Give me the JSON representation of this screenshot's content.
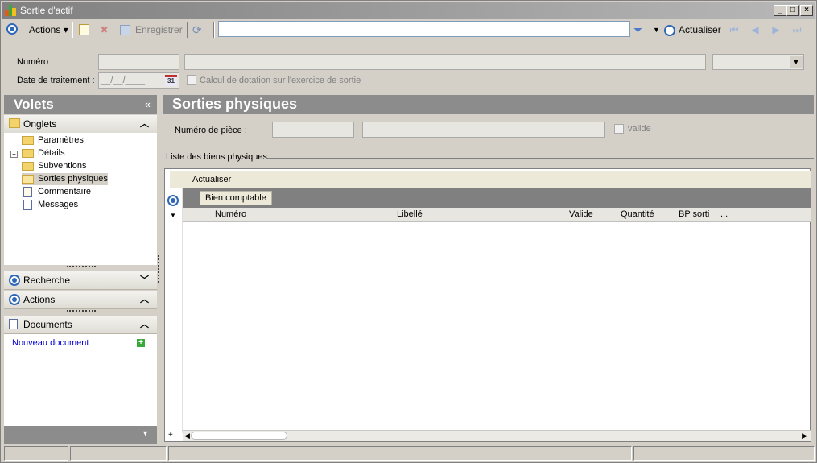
{
  "window": {
    "title": "Sortie d'actif"
  },
  "toolbar": {
    "actions_label": "Actions",
    "save_label": "Enregistrer",
    "refresh_label": "Actualiser",
    "search_value": ""
  },
  "header": {
    "numero_label": "Numéro :",
    "date_label": "Date de traitement :",
    "date_placeholder": "__/__/____",
    "calendar_day": "31",
    "dotation_label": "Calcul de dotation sur l'exercice de sortie"
  },
  "left": {
    "volets_title": "Volets",
    "onglets_title": "Onglets",
    "tree": [
      {
        "label": "Paramètres"
      },
      {
        "label": "Détails"
      },
      {
        "label": "Subventions"
      },
      {
        "label": "Sorties physiques"
      },
      {
        "label": "Commentaire"
      },
      {
        "label": "Messages"
      }
    ],
    "recherche_title": "Recherche",
    "actions_title": "Actions",
    "documents_title": "Documents",
    "new_document_label": "Nouveau document"
  },
  "main": {
    "title": "Sorties physiques",
    "piece_label": "Numéro de pièce :",
    "valide_label": "valide",
    "list_title": "Liste des biens physiques",
    "grid_refresh_label": "Actualiser",
    "group_chip": "Bien comptable",
    "columns": [
      "Numéro",
      "Libellé",
      "Valide",
      "Quantité",
      "BP sorti",
      "..."
    ]
  },
  "colors": {
    "accent": "#2e67b8",
    "panel_head": "#8c8c8c",
    "link": "#0000cc"
  }
}
